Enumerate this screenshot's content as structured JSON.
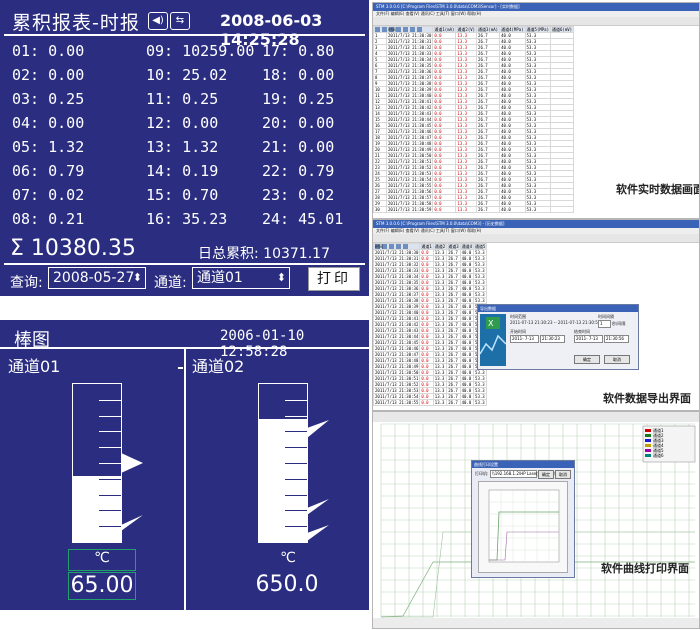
{
  "report": {
    "title": "累积报表-时报",
    "icon_speaker": "speaker-icon",
    "icon_usb": "usb-icon",
    "datetime": "2008-06-03 14:25:28",
    "columns": [
      [
        {
          "label": "01:",
          "value": "0.00"
        },
        {
          "label": "02:",
          "value": "0.00"
        },
        {
          "label": "03:",
          "value": "0.25"
        },
        {
          "label": "04:",
          "value": "0.00"
        },
        {
          "label": "05:",
          "value": "1.32"
        },
        {
          "label": "06:",
          "value": "0.79"
        },
        {
          "label": "07:",
          "value": "0.02"
        },
        {
          "label": "08:",
          "value": "0.21"
        }
      ],
      [
        {
          "label": "09:",
          "value": "10259.00"
        },
        {
          "label": "10:",
          "value": "25.02"
        },
        {
          "label": "11:",
          "value": "0.25"
        },
        {
          "label": "12:",
          "value": "0.00"
        },
        {
          "label": "13:",
          "value": "1.32"
        },
        {
          "label": "14:",
          "value": "0.19"
        },
        {
          "label": "15:",
          "value": "0.70"
        },
        {
          "label": "16:",
          "value": "35.23"
        }
      ],
      [
        {
          "label": "17:",
          "value": "0.80"
        },
        {
          "label": "18:",
          "value": "0.00"
        },
        {
          "label": "19:",
          "value": "0.25"
        },
        {
          "label": "20:",
          "value": "0.00"
        },
        {
          "label": "21:",
          "value": "0.00"
        },
        {
          "label": "22:",
          "value": "0.79"
        },
        {
          "label": "23:",
          "value": "0.02"
        },
        {
          "label": "24:",
          "value": "45.01"
        }
      ]
    ],
    "sum_symbol": "Σ",
    "sum_value": "10380.35",
    "daily_label": "日总累积:",
    "daily_value": "10371.17",
    "query_label": "查询:",
    "query_date": "2008-05-27",
    "channel_label": "通道:",
    "channel_value": "通道01",
    "print_label": "打印"
  },
  "bars": {
    "title": "棒图",
    "datetime": "2006-01-10 12:58:28",
    "channels": [
      {
        "name": "通道01",
        "unit": "℃",
        "value": "65.00",
        "level": 0.42
      },
      {
        "name": "通道02",
        "unit": "℃",
        "value": "650.0",
        "level": 0.78
      }
    ]
  },
  "screens": {
    "realtime": {
      "caption": "软件实时数据画面",
      "window_title": "STM 3.0.0.6 [C:\\Program Files\\STM 3.0.0\\data\\COM3\\Sensor] - [实时数据]",
      "menu": "文件(F)  编辑(E)  查看(V)  通讯(C)  工具(T)  窗口(W)  帮助(H)",
      "headers": [
        "",
        "时间",
        "通道1(mA)",
        "通道2(V)",
        "通道3(mA)",
        "通道4(MPa)",
        "通道5(MPa)",
        "通道6(mV)"
      ],
      "row_template": [
        "2011/7/13 21:30:",
        "0.0",
        "13.3",
        "26.7",
        "40.0",
        "53.3"
      ],
      "row_count": 30
    },
    "export": {
      "caption": "软件数据导出界面",
      "window_title": "STM 3.0.0.6 [C:\\Program Files\\STM 3.0.0\\data\\COM3] - [历史数据]",
      "menu": "文件(F)  编辑(E)  查看(V)  通讯(C)  工具(T)  窗口(W)  帮助(H)",
      "headers": [
        "时间",
        "通道1",
        "通道2",
        "通道3",
        "通道4",
        "通道5"
      ],
      "dialog_title": "导出数据",
      "dialog_range_label": "时间范围",
      "dialog_range_text": "2011-07-13 21:30:23 -- 2011-07-13 21:30:57",
      "dialog_start_label": "开始时间",
      "dialog_start_date": "2011- 7-13",
      "dialog_start_time": "21:30:23",
      "dialog_end_label": "结束时间",
      "dialog_end_date": "2011- 7-13",
      "dialog_end_time": "21:30:56",
      "dialog_interval_label": "时间间隔",
      "dialog_interval_value": "1",
      "dialog_interval_unit": "秒/间隔",
      "dialog_ok": "确定",
      "dialog_cancel": "取消"
    },
    "curve": {
      "caption": "软件曲线打印界面",
      "dialog_title": "曲线打印设置",
      "printer_label": "打印机:",
      "printer_value": "\\\\192.168.1.2\\HP LaserJet P1008",
      "dialog_ok": "确定",
      "dialog_cancel": "取消",
      "legend": [
        "通道1",
        "通道2",
        "通道3",
        "通道4",
        "通道5",
        "通道6"
      ]
    }
  },
  "colors": {
    "panel_bg": "#2a2d80",
    "panel_fg": "#ffffff",
    "unit_border": "#22a06b",
    "red_value": "#d00000",
    "win_title": "#3a63b8"
  }
}
